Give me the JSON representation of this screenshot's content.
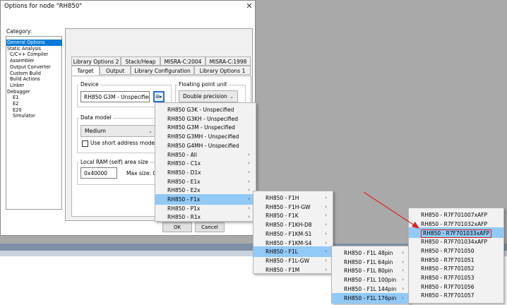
{
  "dialog": {
    "title": "Options for node \"RH850\"",
    "close_glyph": "✕",
    "category_label": "Category:",
    "categories": [
      {
        "label": "General Options",
        "selected": true,
        "indent": 0
      },
      {
        "label": "Static Analysis",
        "indent": 0
      },
      {
        "label": "C/C++ Compiler",
        "indent": 1
      },
      {
        "label": "Assembler",
        "indent": 1
      },
      {
        "label": "Output Converter",
        "indent": 1
      },
      {
        "label": "Custom Build",
        "indent": 1
      },
      {
        "label": "Build Actions",
        "indent": 1
      },
      {
        "label": "Linker",
        "indent": 1
      },
      {
        "label": "Debugger",
        "indent": 0
      },
      {
        "label": "E1",
        "indent": 2
      },
      {
        "label": "E2",
        "indent": 2
      },
      {
        "label": "E20",
        "indent": 2
      },
      {
        "label": "Simulator",
        "indent": 2
      }
    ],
    "tabs_row1": [
      "Library Options 2",
      "Stack/Heap",
      "MISRA-C:2004",
      "MISRA-C:1998"
    ],
    "tabs_row2": [
      "Target",
      "Output",
      "Library Configuration",
      "Library Options 1"
    ],
    "device": {
      "label": "Device",
      "value": "RH850 G3M - Unspecified"
    },
    "fpu": {
      "label": "Floating point unit",
      "value": "Double precision"
    },
    "data_model": {
      "label": "Data model",
      "value": "Medium",
      "checkbox_label": "Use short address mode"
    },
    "local_ram": {
      "label": "Local RAM (self) area size",
      "value": "0x40000",
      "size_label": "Max size: 0"
    },
    "buttons": {
      "ok": "OK",
      "cancel": "Cancel"
    }
  },
  "menu1": {
    "items": [
      {
        "label": "RH850 G3K - Unspecified",
        "submenu": false
      },
      {
        "label": "RH850 G3KH - Unspecified",
        "submenu": false
      },
      {
        "label": "RH850 G3M - Unspecified",
        "submenu": false
      },
      {
        "label": "RH850 G3MH - Unspecified",
        "submenu": false
      },
      {
        "label": "RH850 G4MH - Unspecified",
        "submenu": false
      },
      {
        "label": "RH850 - All",
        "submenu": true
      },
      {
        "label": "RH850 - C1x",
        "submenu": true
      },
      {
        "label": "RH850 - D1x",
        "submenu": true
      },
      {
        "label": "RH850 - E1x",
        "submenu": true
      },
      {
        "label": "RH850 - E2x",
        "submenu": true
      },
      {
        "label": "RH850 - F1x",
        "submenu": true,
        "highlighted": true
      },
      {
        "label": "RH850 - P1x",
        "submenu": true
      },
      {
        "label": "RH850 - R1x",
        "submenu": true
      }
    ]
  },
  "menu2": {
    "items": [
      {
        "label": "RH850 - F1H",
        "submenu": true
      },
      {
        "label": "RH850 - F1H-GW",
        "submenu": true
      },
      {
        "label": "RH850 - F1K",
        "submenu": true
      },
      {
        "label": "RH850 - F1KH-D8",
        "submenu": true
      },
      {
        "label": "RH850 - F1KM-S1",
        "submenu": true
      },
      {
        "label": "RH850 - F1KM-S4",
        "submenu": true
      },
      {
        "label": "RH850 - F1L",
        "submenu": true,
        "highlighted": true
      },
      {
        "label": "RH850 - F1L-GW",
        "submenu": true
      },
      {
        "label": "RH850 - F1M",
        "submenu": true
      }
    ]
  },
  "menu3": {
    "items": [
      {
        "label": "RH850 - F1L  48pin",
        "submenu": true
      },
      {
        "label": "RH850 - F1L  64pin",
        "submenu": true
      },
      {
        "label": "RH850 - F1L  80pin",
        "submenu": true
      },
      {
        "label": "RH850 - F1L  100pin",
        "submenu": true
      },
      {
        "label": "RH850 - F1L  144pin",
        "submenu": true
      },
      {
        "label": "RH850 - F1L  176pin",
        "submenu": true,
        "highlighted": true
      }
    ]
  },
  "menu4": {
    "items": [
      {
        "label": "RH850 - R7F701007xAFP"
      },
      {
        "label": "RH850 - R7F701032xAFP"
      },
      {
        "label": "RH850 - R7F701033xAFP",
        "highlighted": true,
        "boxed": true
      },
      {
        "label": "RH850 - R7F701034xAFP"
      },
      {
        "label": "RH850 - R7F701050"
      },
      {
        "label": "RH850 - R7F701051"
      },
      {
        "label": "RH850 - R7F701052"
      },
      {
        "label": "RH850 - R7F701053"
      },
      {
        "label": "RH850 - R7F701056"
      },
      {
        "label": "RH850 - R7F701057"
      }
    ]
  },
  "colors": {
    "selection": "#0078d7",
    "menu_highlight": "#91c9f7",
    "annotation": "#e02020"
  },
  "glyphs": {
    "submenu_arrow": "›",
    "combo_arrow": "⌄",
    "device_button": "⊞▸"
  }
}
